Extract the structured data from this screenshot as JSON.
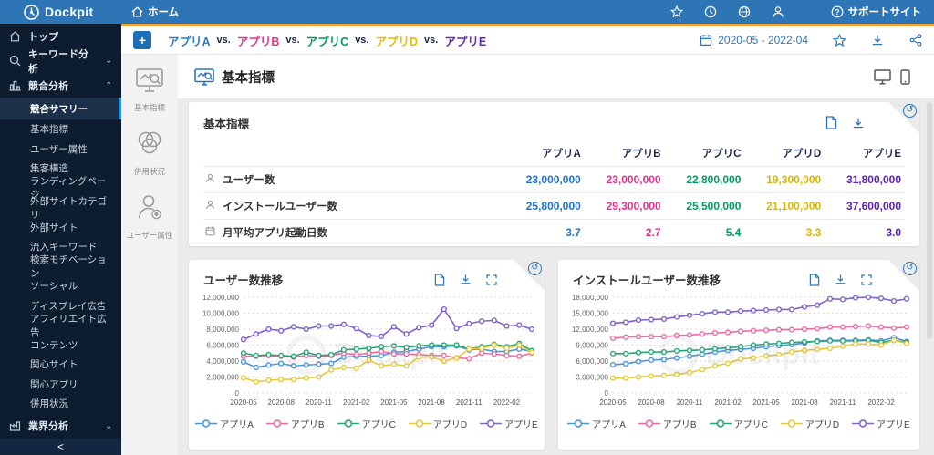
{
  "topbar": {
    "brand": "Dockpit",
    "home_label": "ホーム",
    "support_label": "サポートサイト"
  },
  "sidebar": {
    "top_label": "トップ",
    "keyword_label": "キーワード分析",
    "competitive_label": "競合分析",
    "industry_label": "業界分析",
    "collapse_label": "<",
    "competitive_sub_items": [
      "競合サマリー",
      "基本指標",
      "ユーザー属性",
      "集客構造",
      "ランディングページ",
      "外部サイトカテゴリ",
      "外部サイト",
      "流入キーワード",
      "検索モチベーション",
      "ソーシャル",
      "ディスプレイ広告",
      "アフィリエイト広告",
      "コンテンツ",
      "関心サイト",
      "関心アプリ",
      "併用状況"
    ],
    "active_sub_item": "競合サマリー"
  },
  "rail": {
    "items": [
      {
        "label": "基本指標",
        "icon": "monitor-chart-icon"
      },
      {
        "label": "併用状況",
        "icon": "venn-icon"
      },
      {
        "label": "ユーザー属性",
        "icon": "user-attr-icon"
      }
    ]
  },
  "compare_header": {
    "separator": "vs.",
    "apps": [
      {
        "name": "アプリA",
        "color": "#2f78c2"
      },
      {
        "name": "アプリB",
        "color": "#e5338e"
      },
      {
        "name": "アプリC",
        "color": "#009a60"
      },
      {
        "name": "アプリD",
        "color": "#e0bd00"
      },
      {
        "name": "アプリE",
        "color": "#6527be"
      }
    ],
    "date_range": "2020-05  -  2022-04"
  },
  "page": {
    "title": "基本指標"
  },
  "metrics_card": {
    "title": "基本指標",
    "columns": [
      "アプリA",
      "アプリB",
      "アプリC",
      "アプリD",
      "アプリE"
    ],
    "column_colors": [
      "#1b2a4a",
      "#1b2a4a",
      "#1b2a4a",
      "#1b2a4a",
      "#1b2a4a"
    ],
    "value_colors": [
      "#1e73c8",
      "#e0338c",
      "#009a60",
      "#d9b600",
      "#5d21b4"
    ],
    "rows": [
      {
        "label": "ユーザー数",
        "icon": "user-icon",
        "values": [
          "23,000,000",
          "23,000,000",
          "22,800,000",
          "19,300,000",
          "31,800,000"
        ]
      },
      {
        "label": "インストールユーザー数",
        "icon": "user-icon",
        "values": [
          "25,800,000",
          "29,300,000",
          "25,500,000",
          "21,100,000",
          "37,600,000"
        ]
      },
      {
        "label": "月平均アプリ起動日数",
        "icon": "calendar-icon",
        "values": [
          "3.7",
          "2.7",
          "5.4",
          "3.3",
          "3.0"
        ]
      }
    ]
  },
  "chart_data": [
    {
      "type": "line",
      "title": "ユーザー数推移",
      "x": [
        "2020-05",
        "2020-06",
        "2020-07",
        "2020-08",
        "2020-09",
        "2020-10",
        "2020-11",
        "2020-12",
        "2021-01",
        "2021-02",
        "2021-03",
        "2021-04",
        "2021-05",
        "2021-06",
        "2021-07",
        "2021-08",
        "2021-09",
        "2021-10",
        "2021-11",
        "2021-12",
        "2022-01",
        "2022-02",
        "2022-03",
        "2022-04"
      ],
      "x_tick_labels": [
        "2020-05",
        "2020-08",
        "2020-11",
        "2021-02",
        "2021-05",
        "2021-08",
        "2021-11",
        "2022-02"
      ],
      "x_tick_every": 3,
      "unit_multiplier": 1000000,
      "ylim": [
        0,
        12000000
      ],
      "y_tick_step": 2000000,
      "grid": true,
      "legend_position": "bottom",
      "series": [
        {
          "name": "アプリA",
          "color": "#4e95d9",
          "values": [
            3.9,
            3.2,
            3.5,
            3.7,
            3.4,
            3.5,
            3.6,
            3.7,
            4.5,
            4.6,
            4.6,
            4.7,
            5.1,
            5.2,
            5.5,
            5.8,
            5.8,
            5.9,
            5.4,
            5.5,
            5.2,
            5.2,
            5.5,
            5.2
          ]
        },
        {
          "name": "アプリB",
          "color": "#ec6ba3",
          "values": [
            4.6,
            4.6,
            4.7,
            4.6,
            4.5,
            4.7,
            4.6,
            4.7,
            5.0,
            4.8,
            5.0,
            5.2,
            4.9,
            4.9,
            4.8,
            4.7,
            4.7,
            4.4,
            4.3,
            5.0,
            4.9,
            4.7,
            4.6,
            5.0
          ]
        },
        {
          "name": "アプリC",
          "color": "#27a578",
          "values": [
            5.0,
            4.7,
            4.8,
            4.7,
            4.6,
            5.1,
            4.7,
            4.8,
            5.4,
            5.5,
            5.6,
            5.8,
            5.9,
            5.7,
            5.9,
            6.0,
            6.0,
            6.0,
            5.5,
            5.8,
            6.1,
            5.8,
            6.2,
            5.3
          ]
        },
        {
          "name": "アプリD",
          "color": "#e6ca3e",
          "values": [
            1.9,
            1.4,
            1.6,
            1.7,
            1.7,
            1.9,
            2.0,
            2.9,
            3.2,
            3.1,
            4.1,
            3.4,
            3.6,
            3.4,
            4.5,
            4.5,
            4.0,
            4.4,
            5.5,
            5.6,
            6.0,
            5.6,
            6.0,
            5.1
          ]
        },
        {
          "name": "アプリE",
          "color": "#7e63c9",
          "values": [
            6.7,
            7.4,
            8.0,
            7.8,
            8.3,
            8.0,
            8.4,
            8.4,
            8.6,
            8.1,
            7.2,
            7.1,
            8.3,
            7.4,
            8.2,
            8.5,
            10.5,
            8.1,
            8.7,
            9.0,
            9.1,
            8.4,
            8.5,
            8.0
          ]
        }
      ]
    },
    {
      "type": "line",
      "title": "インストールユーザー数推移",
      "x": [
        "2020-05",
        "2020-06",
        "2020-07",
        "2020-08",
        "2020-09",
        "2020-10",
        "2020-11",
        "2020-12",
        "2021-01",
        "2021-02",
        "2021-03",
        "2021-04",
        "2021-05",
        "2021-06",
        "2021-07",
        "2021-08",
        "2021-09",
        "2021-10",
        "2021-11",
        "2021-12",
        "2022-01",
        "2022-02",
        "2022-03",
        "2022-04"
      ],
      "x_tick_labels": [
        "2020-05",
        "2020-08",
        "2020-11",
        "2021-02",
        "2021-05",
        "2021-08",
        "2021-11",
        "2022-02"
      ],
      "x_tick_every": 3,
      "unit_multiplier": 1000000,
      "ylim": [
        0,
        18000000
      ],
      "y_tick_step": 3000000,
      "grid": true,
      "legend_position": "bottom",
      "series": [
        {
          "name": "アプリA",
          "color": "#4e95d9",
          "values": [
            5.3,
            5.5,
            5.9,
            6.2,
            6.3,
            6.6,
            6.9,
            7.3,
            7.7,
            8.0,
            8.2,
            8.4,
            8.7,
            8.9,
            9.1,
            9.4,
            9.8,
            9.9,
            9.9,
            9.9,
            10.0,
            9.8,
            10.4,
            9.7
          ]
        },
        {
          "name": "アプリB",
          "color": "#ec6ba3",
          "values": [
            10.3,
            10.5,
            10.6,
            10.6,
            10.6,
            10.8,
            10.9,
            11.1,
            11.3,
            11.4,
            11.6,
            11.7,
            11.8,
            11.9,
            11.9,
            12.0,
            12.1,
            12.4,
            12.4,
            12.5,
            12.6,
            12.4,
            12.2,
            12.4
          ]
        },
        {
          "name": "アプリC",
          "color": "#27a578",
          "values": [
            7.4,
            7.4,
            7.6,
            7.7,
            7.7,
            7.9,
            8.0,
            8.1,
            8.3,
            8.5,
            8.7,
            9.0,
            9.2,
            9.3,
            9.5,
            9.6,
            9.7,
            9.8,
            9.8,
            9.8,
            9.9,
            9.5,
            9.9,
            9.5
          ]
        },
        {
          "name": "アプリD",
          "color": "#e6ca3e",
          "values": [
            2.8,
            2.8,
            3.0,
            3.2,
            3.3,
            3.5,
            3.8,
            4.4,
            5.1,
            5.6,
            6.4,
            6.6,
            7.0,
            7.2,
            7.7,
            8.0,
            8.2,
            8.4,
            8.8,
            9.2,
            9.2,
            9.0,
            9.9,
            9.3
          ]
        },
        {
          "name": "アプリE",
          "color": "#7e63c9",
          "values": [
            13.1,
            13.3,
            13.7,
            13.8,
            13.9,
            14.3,
            14.6,
            14.9,
            15.2,
            15.2,
            15.4,
            15.5,
            15.6,
            15.7,
            15.7,
            16.2,
            16.5,
            17.7,
            17.6,
            17.9,
            18.0,
            17.8,
            17.3,
            17.7
          ]
        }
      ]
    }
  ],
  "watermark_text": "Dockpit"
}
